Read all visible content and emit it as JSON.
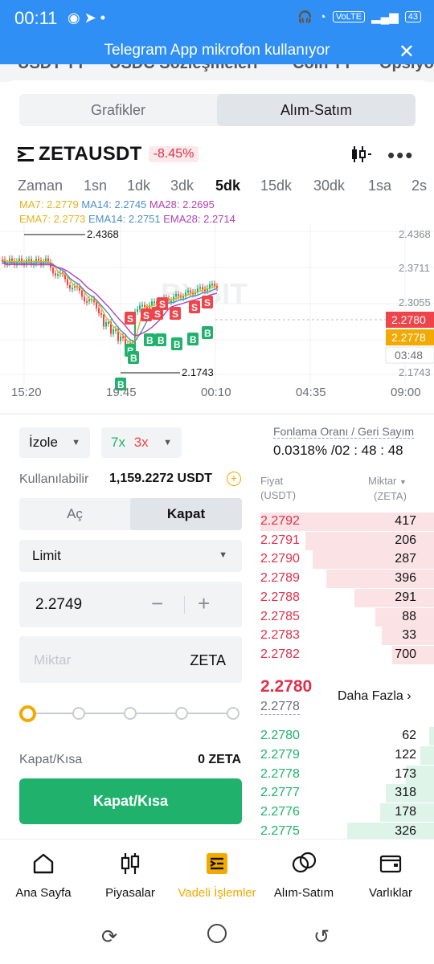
{
  "status_bar": {
    "time": "00:11",
    "network": "VoLTE",
    "battery": "43"
  },
  "banner": {
    "text": "Telegram App mikrofon kullanıyor"
  },
  "peek_tabs": [
    "USDT TT",
    "USDC Sözleşmeleri",
    "Coin TT",
    "Opsiyon"
  ],
  "mode_tabs": {
    "left": "Grafikler",
    "right": "Alım-Satım"
  },
  "symbol": {
    "name": "ZETAUSDT",
    "change": "-8.45%"
  },
  "timeframes": [
    "Zaman",
    "1sn",
    "1dk",
    "3dk",
    "5dk",
    "15dk",
    "30dk",
    "1sa",
    "2s"
  ],
  "timeframe_active": "5dk",
  "ma": {
    "row1": [
      "MA7: 2.2779",
      "MA14: 2.2745",
      "MA28: 2.2695"
    ],
    "row2": [
      "EMA7: 2.2773",
      "EMA14: 2.2751",
      "EMA28: 2.2714"
    ]
  },
  "chart": {
    "price_ticks": [
      "2.4368",
      "2.3711",
      "2.3055",
      "2.1743"
    ],
    "high_label": "2.4368",
    "low_label": "2.1743",
    "last_price": "2.2780",
    "mark_price": "2.2778",
    "countdown": "03:48",
    "time_labels": [
      "15:20",
      "19:45",
      "00:10",
      "04:35",
      "09:00"
    ],
    "watermark": "BYBIT",
    "sell_marker": "S",
    "buy_marker": "B",
    "colors": {
      "up": "#20b26c",
      "down": "#ef454a",
      "ma7": "#e7b21a",
      "ma14": "#4d8fc7",
      "ma28": "#b043b5"
    }
  },
  "order_form": {
    "margin_mode": "İzole",
    "leverage_long": "7x",
    "leverage_short": "3x",
    "available_label": "Kullanılabilir",
    "available_value": "1,159.2272 USDT",
    "open_tab": "Aç",
    "close_tab": "Kapat",
    "order_type": "Limit",
    "price_value": "2.2749",
    "qty_placeholder": "Miktar",
    "qty_unit": "ZETA",
    "slider_value": 0,
    "close_short_label": "Kapat/Kısa",
    "close_short_value": "0 ZETA",
    "close_short_button": "Kapat/Kısa"
  },
  "funding": {
    "label": "Fonlama Oranı / Geri Sayım",
    "value": "0.0318% /02 : 48 : 48"
  },
  "orderbook": {
    "price_header": [
      "Fiyat",
      "(USDT)"
    ],
    "qty_header": [
      "Miktar",
      "(ZETA)"
    ],
    "asks": [
      {
        "price": "2.2792",
        "qty": "417",
        "depth": 1.0
      },
      {
        "price": "2.2791",
        "qty": "206",
        "depth": 0.74
      },
      {
        "price": "2.2790",
        "qty": "287",
        "depth": 0.7
      },
      {
        "price": "2.2789",
        "qty": "396",
        "depth": 0.62
      },
      {
        "price": "2.2788",
        "qty": "291",
        "depth": 0.46
      },
      {
        "price": "2.2785",
        "qty": "88",
        "depth": 0.34
      },
      {
        "price": "2.2783",
        "qty": "33",
        "depth": 0.3
      },
      {
        "price": "2.2782",
        "qty": "700",
        "depth": 0.24
      }
    ],
    "last_price": "2.2780",
    "mark_price": "2.2778",
    "more_label": "Daha Fazla",
    "bids": [
      {
        "price": "2.2780",
        "qty": "62",
        "depth": 0.03
      },
      {
        "price": "2.2779",
        "qty": "122",
        "depth": 0.08
      },
      {
        "price": "2.2778",
        "qty": "173",
        "depth": 0.16
      },
      {
        "price": "2.2777",
        "qty": "318",
        "depth": 0.28
      },
      {
        "price": "2.2776",
        "qty": "178",
        "depth": 0.31
      },
      {
        "price": "2.2775",
        "qty": "326",
        "depth": 0.5
      }
    ]
  },
  "bottom_nav": [
    {
      "label": "Ana Sayfa",
      "icon": "home-icon",
      "active": false
    },
    {
      "label": "Piyasalar",
      "icon": "candles-icon",
      "active": false
    },
    {
      "label": "Vadeli İşlemler",
      "icon": "futures-icon",
      "active": true
    },
    {
      "label": "Alım-Satım",
      "icon": "exchange-icon",
      "active": false
    },
    {
      "label": "Varlıklar",
      "icon": "wallet-icon",
      "active": false
    }
  ],
  "accent": "#f2a900"
}
